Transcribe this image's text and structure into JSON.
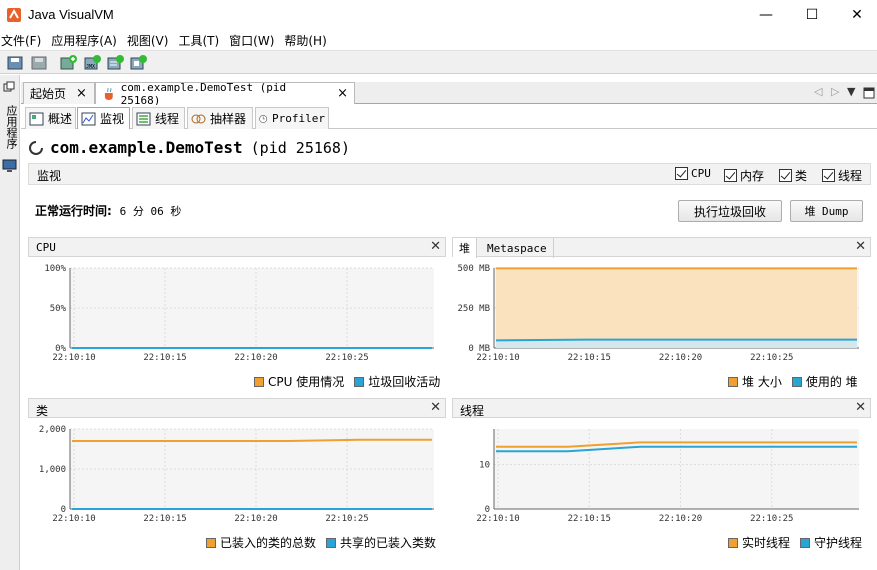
{
  "window": {
    "title": "Java VisualVM",
    "minimize": "—",
    "maximize": "☐",
    "close": "✕"
  },
  "menu": [
    "文件(F)",
    "应用程序(A)",
    "视图(V)",
    "工具(T)",
    "窗口(W)",
    "帮助(H)"
  ],
  "left_strip_label": "应用程序",
  "doc_tabs": [
    {
      "label": "起始页",
      "close": "×"
    },
    {
      "label": "com.example.DemoTest (pid 25168)",
      "close": "×"
    }
  ],
  "sub_tabs": [
    "概述",
    "监视",
    "线程",
    "抽样器",
    "Profiler"
  ],
  "process": {
    "name": "com.example.DemoTest",
    "pid": "(pid 25168)"
  },
  "monitor": {
    "label": "监视",
    "checks": [
      "CPU",
      "内存",
      "类",
      "线程"
    ],
    "uptime_label": "正常运行时间:",
    "uptime_value": "6 分 06 秒",
    "gc_button": "执行垃圾回收",
    "heap_dump_button": "堆 Dump"
  },
  "panels": {
    "cpu": {
      "title": "CPU",
      "legend": [
        "CPU 使用情况",
        "垃圾回收活动"
      ]
    },
    "heap": {
      "tabs": [
        "堆",
        "Metaspace"
      ],
      "legend": [
        "堆 大小",
        "使用的 堆"
      ]
    },
    "classes": {
      "title": "类",
      "legend": [
        "已装入的类的总数",
        "共享的已装入类数"
      ]
    },
    "threads": {
      "title": "线程",
      "legend": [
        "实时线程",
        "守护线程"
      ]
    }
  },
  "colors": {
    "orange": "#f0a030",
    "blue": "#2aa4d4",
    "fill_orange": "#fbe0b8"
  },
  "chart_data": [
    {
      "type": "area",
      "name": "CPU",
      "x": [
        "22:10:10",
        "22:10:15",
        "22:10:20",
        "22:10:25"
      ],
      "yticks": [
        "100%",
        "50%",
        "0%"
      ],
      "ylim": [
        0,
        100
      ],
      "series": [
        {
          "name": "CPU 使用情况",
          "values": [
            0,
            0,
            0,
            0,
            0
          ]
        },
        {
          "name": "垃圾回收活动",
          "values": [
            0,
            0,
            0,
            0,
            0
          ]
        }
      ],
      "grid": true
    },
    {
      "type": "area",
      "name": "堆",
      "x": [
        "22:10:10",
        "22:10:15",
        "22:10:20",
        "22:10:25"
      ],
      "yticks": [
        "500 MB",
        "250 MB",
        "0 MB"
      ],
      "ylim": [
        0,
        500
      ],
      "series": [
        {
          "name": "堆 大小",
          "values": [
            498,
            498,
            498,
            498,
            498
          ]
        },
        {
          "name": "使用的 堆",
          "values": [
            48,
            52,
            52,
            52,
            52
          ]
        }
      ],
      "grid": true
    },
    {
      "type": "line",
      "name": "类",
      "x": [
        "22:10:10",
        "22:10:15",
        "22:10:20",
        "22:10:25"
      ],
      "yticks": [
        "2,000",
        "1,000",
        "0"
      ],
      "ylim": [
        0,
        2000
      ],
      "series": [
        {
          "name": "已装入的类的总数",
          "values": [
            1700,
            1700,
            1700,
            1700,
            1730,
            1730
          ]
        },
        {
          "name": "共享的已装入类数",
          "values": [
            0,
            0,
            0,
            0,
            0,
            0
          ]
        }
      ],
      "grid": true
    },
    {
      "type": "line",
      "name": "线程",
      "x": [
        "22:10:10",
        "22:10:15",
        "22:10:20",
        "22:10:25"
      ],
      "yticks": [
        "10",
        "0"
      ],
      "ylim": [
        0,
        18
      ],
      "series": [
        {
          "name": "实时线程",
          "values": [
            14,
            14,
            15,
            15,
            15,
            15
          ]
        },
        {
          "name": "守护线程",
          "values": [
            13,
            13,
            14,
            14,
            14,
            14
          ]
        }
      ],
      "grid": true
    }
  ]
}
